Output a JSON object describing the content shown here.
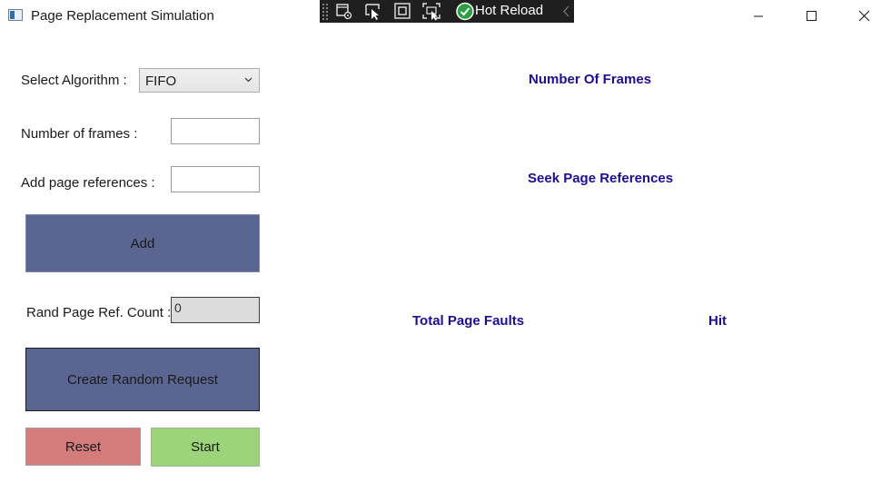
{
  "window": {
    "title": "Page Replacement Simulation"
  },
  "dev_toolbar": {
    "hot_reload_label": "Hot Reload",
    "icons": [
      "select-element-icon",
      "cursor-select-icon",
      "display-layout-adorners-icon",
      "track-focus-icon",
      "hot-reload-check-icon",
      "collapse-chevron-icon"
    ],
    "check_color": "#2ea043"
  },
  "form": {
    "algorithm_label": "Select Algorithm :",
    "algorithm_value": "FIFO",
    "frames_label": "Number of frames :",
    "frames_value": "",
    "page_refs_label": "Add page references :",
    "page_refs_value": "",
    "add_label": "Add",
    "rand_count_label": "Rand Page Ref. Count :",
    "rand_count_value": "0",
    "random_label": "Create Random Request",
    "reset_label": "Reset",
    "start_label": "Start"
  },
  "results": {
    "frames_heading": "Number Of Frames",
    "refs_heading": "Seek Page References",
    "faults_heading": "Total Page Faults",
    "hit_heading": "Hit"
  },
  "colors": {
    "button_primary": "#5a6591",
    "button_reset": "#d47b7b",
    "button_start": "#9cd47b",
    "heading_text": "#1d0e8c",
    "readonly_field": "#dcdcdc"
  }
}
